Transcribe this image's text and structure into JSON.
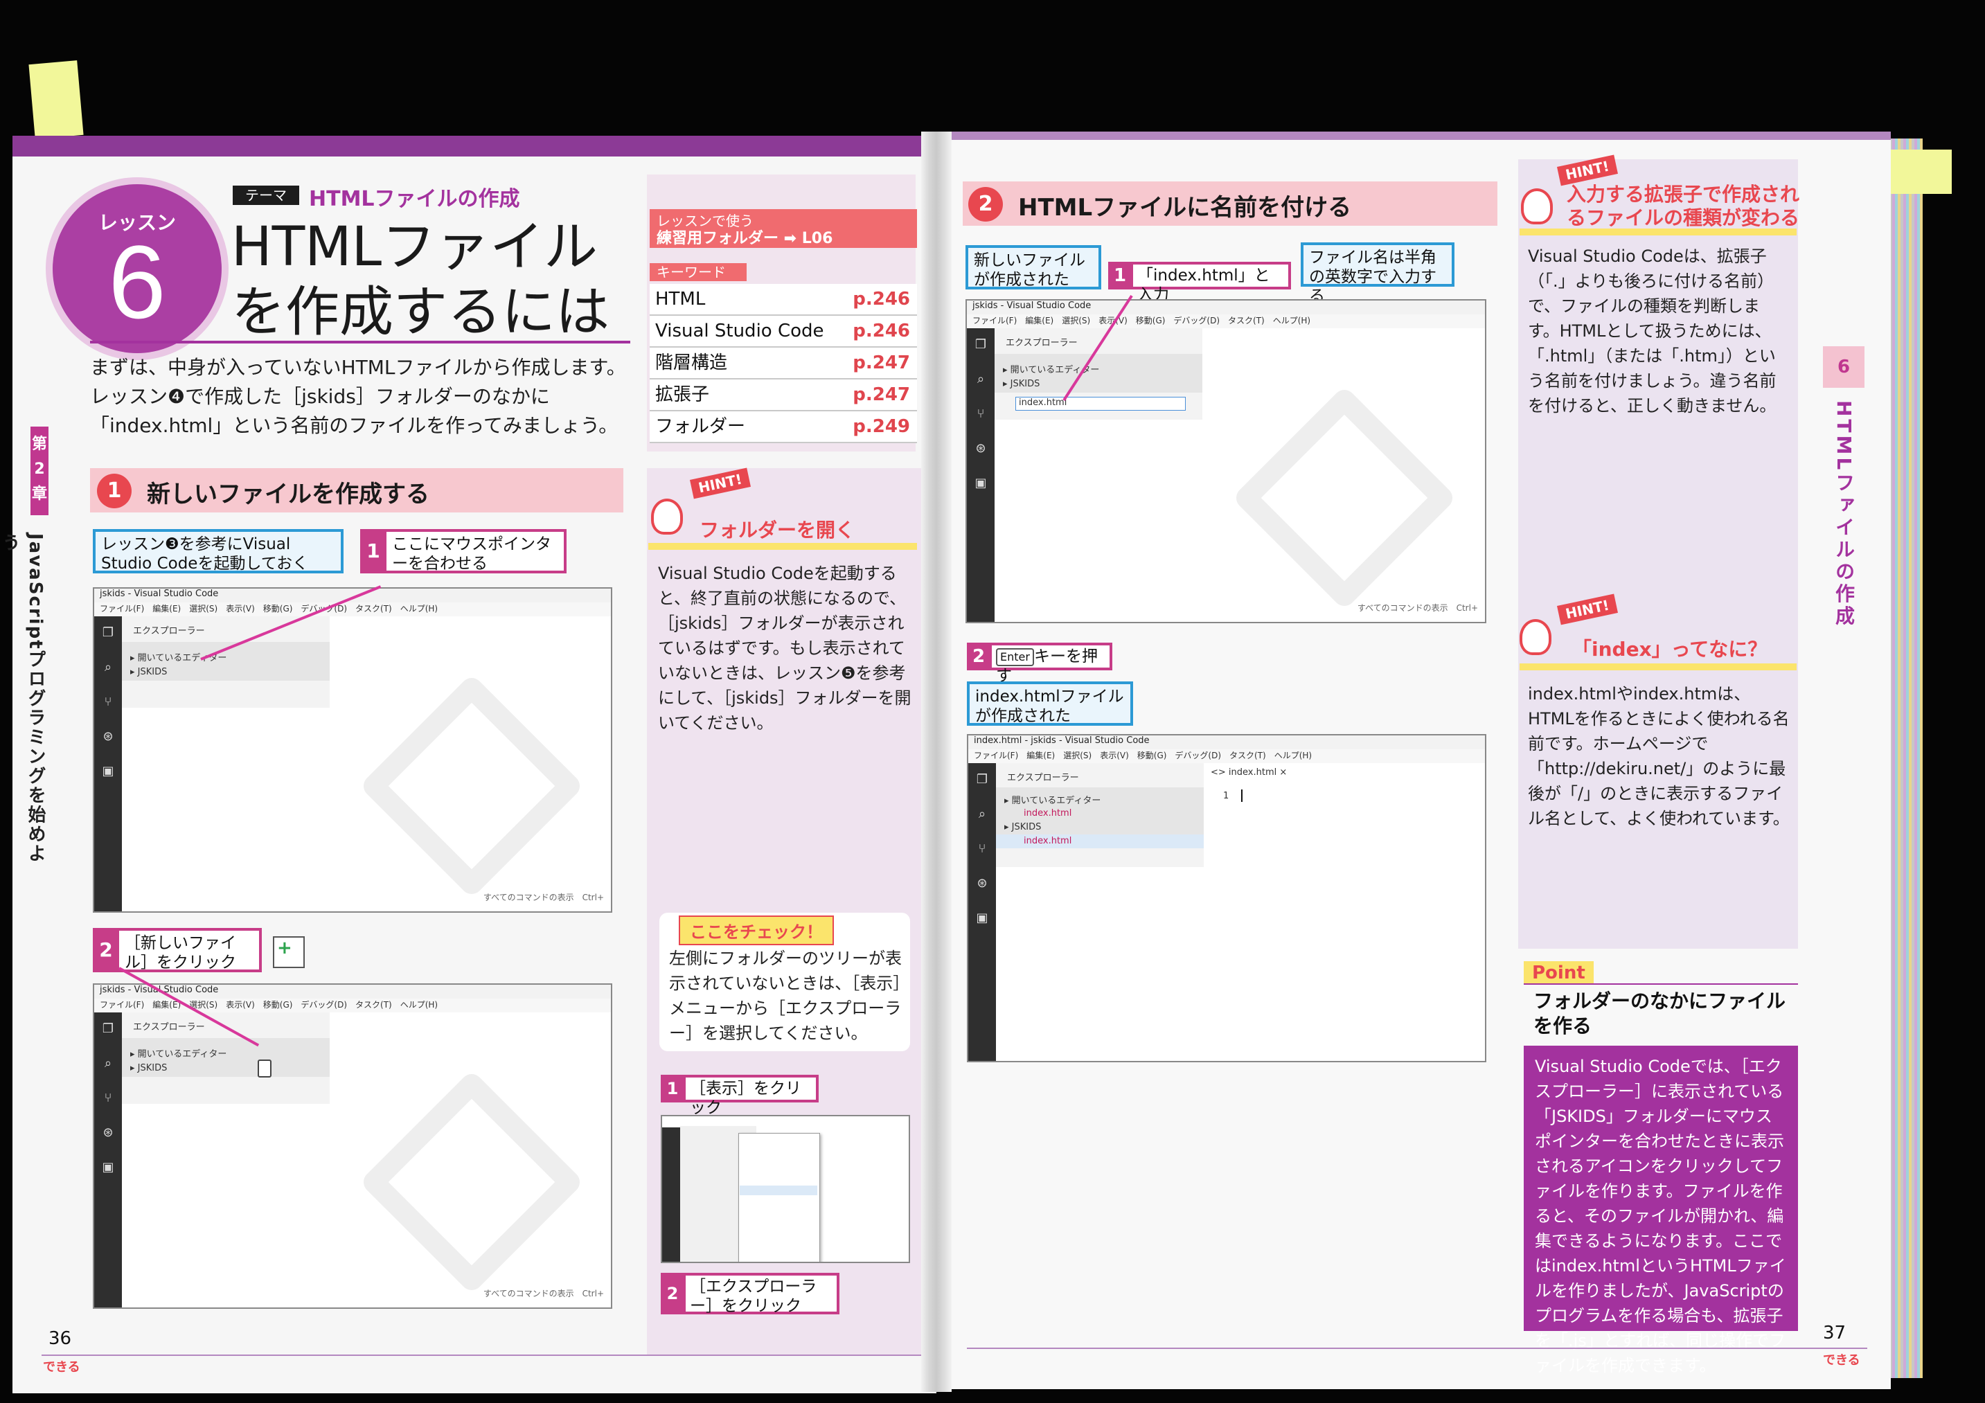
{
  "left": {
    "chapter_num": "第2章",
    "chapter_title": "JavaScriptプログラミングを始めよう",
    "lesson_label": "レッスン",
    "lesson_number": "6",
    "theme_tag": "テーマ",
    "theme": "HTMLファイルの作成",
    "title": "HTMLファイルを作成するには",
    "intro": "まずは、中身が入っていないHTMLファイルから作成します。レッスン❹で作成した［jskids］フォルダーのなかに「index.html」という名前のファイルを作ってみましょう。",
    "use_label": "レッスンで使う",
    "use_folder": "練習用フォルダー ➡ L06",
    "keyword_label": "キーワード",
    "keywords": [
      {
        "term": "HTML",
        "page": "p.246"
      },
      {
        "term": "Visual Studio Code",
        "page": "p.246"
      },
      {
        "term": "階層構造",
        "page": "p.247"
      },
      {
        "term": "拡張子",
        "page": "p.247"
      },
      {
        "term": "フォルダー",
        "page": "p.249"
      }
    ],
    "step1_num": "1",
    "step1_title": "新しいファイルを作成する",
    "step1_note": "レッスン❸を参考にVisual Studio Codeを起動しておく",
    "step1_callout_num": "1",
    "step1_callout": "ここにマウスポインターを合わせる",
    "step1_callout2_num": "2",
    "step1_callout2": "［新しいファイル］をクリック",
    "shot1": {
      "title": "jskids - Visual Studio Code",
      "menu": "ファイル(F)　編集(E)　選択(S)　表示(V)　移動(G)　デバッグ(D)　タスク(T)　ヘルプ(H)",
      "explorer": "エクスプローラー",
      "open_editors": "▸ 開いているエディター",
      "folder": "▸ JSKIDS",
      "footer": "すべてのコマンドの表示　Ctrl+"
    },
    "hint1_tab": "HINT!",
    "hint1_title": "フォルダーを開く",
    "hint1_body": "Visual Studio Codeを起動すると、終了直前の状態になるので、［jskids］フォルダーが表示されているはずです。もし表示されていないときは、レッスン❺を参考にして、［jskids］フォルダーを開いてください。",
    "check_tag": "ここをチェック！",
    "check_body": "左側にフォルダーのツリーが表示されていないときは、［表示］メニューから［エクスプローラー］を選択してください。",
    "check_step1_num": "1",
    "check_step1": "［表示］をクリック",
    "check_step2_num": "2",
    "check_step2": "［エクスプローラー］をクリック",
    "page_number": "36",
    "brand": "できる"
  },
  "right": {
    "step2_num": "2",
    "step2_title": "HTMLファイルに名前を付ける",
    "note_created": "新しいファイルが作成された",
    "callout1_num": "1",
    "callout1": "「index.html」と入力",
    "note_halfwidth": "ファイル名は半角の英数字で入力する",
    "shot_a": {
      "title": "jskids - Visual Studio Code",
      "menu": "ファイル(F)　編集(E)　選択(S)　表示(V)　移動(G)　デバッグ(D)　タスク(T)　ヘルプ(H)",
      "explorer": "エクスプローラー",
      "open_editors": "▸ 開いているエディター",
      "folder": "▸ JSKIDS",
      "input": "index.html",
      "footer": "すべてのコマンドの表示　Ctrl+"
    },
    "callout2_num": "2",
    "callout2_key": "Enter",
    "callout2": "キーを押す",
    "note_index_created": "index.htmlファイルが作成された",
    "shot_b": {
      "title": "index.html - jskids - Visual Studio Code",
      "menu": "ファイル(F)　編集(E)　選択(S)　表示(V)　移動(G)　デバッグ(D)　タスク(T)　ヘルプ(H)",
      "explorer": "エクスプローラー",
      "tab": "<> index.html ×",
      "open_editors": "▸ 開いているエディター",
      "open_file": "index.html",
      "folder": "▸ JSKIDS",
      "folder_file": "index.html",
      "line": "1"
    },
    "hint2_tab": "HINT!",
    "hint2_title": "入力する拡張子で作成されるファイルの種類が変わる",
    "hint2_body": "Visual Studio Codeは、拡張子（「.」よりも後ろに付ける名前）で、ファイルの種類を判断します。HTMLとして扱うためには、「.html」（または「.htm」）という名前を付けましょう。違う名前を付けると、正しく動きません。",
    "hint3_tab": "HINT!",
    "hint3_title": "「index」ってなに？",
    "hint3_body": "index.htmlやindex.htmは、HTMLを作るときによく使われる名前です。ホームページで「http://dekiru.net/」のように最後が「/」のときに表示するファイル名として、よく使われています。",
    "point_tag": "Point",
    "point_title": "フォルダーのなかにファイルを作る",
    "point_body": "Visual Studio Codeでは、［エクスプローラー］に表示されている「JSKIDS」フォルダーにマウスポインターを合わせたときに表示されるアイコンをクリックしてファイルを作ります。ファイルを作ると、そのファイルが開かれ、編集できるようになります。ここではindex.htmlというHTMLファイルを作りましたが、JavaScriptのプログラムを作る場合も、拡張子を「.js」とすれば、同じ操作でファイルを作成できます。",
    "side_num": "6",
    "side_title": "HTMLファイルの作成",
    "page_number": "37",
    "brand": "できる"
  }
}
